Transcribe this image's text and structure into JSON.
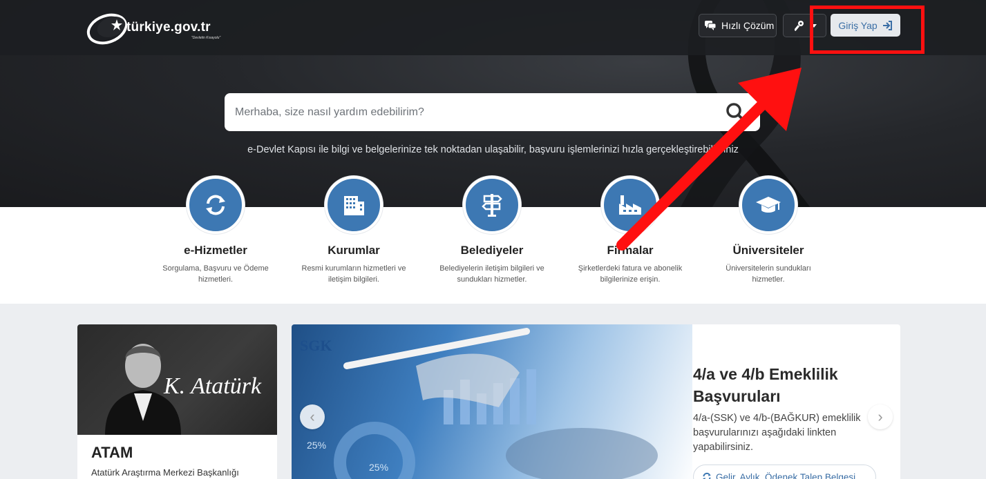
{
  "header": {
    "logo_text": "türkiye.gov.tr",
    "logo_sub": "\"Devletin Kısayolu\"",
    "hizli_cozum_label": "Hızlı Çözüm",
    "giris_label": "Giriş Yap"
  },
  "search": {
    "placeholder": "Merhaba, size nasıl yardım edebilirim?"
  },
  "tagline": "e-Devlet Kapısı ile bilgi ve belgelerinize tek noktadan ulaşabilir, başvuru işlemlerinizi hızla gerçekleştirebilirsiniz",
  "categories": [
    {
      "title": "e-Hizmetler",
      "desc": "Sorgulama, Başvuru ve Ödeme hizmetleri.",
      "icon": "refresh-icon"
    },
    {
      "title": "Kurumlar",
      "desc": "Resmi kurumların hizmetleri ve iletişim bilgileri.",
      "icon": "building-icon"
    },
    {
      "title": "Belediyeler",
      "desc": "Belediyelerin iletişim bilgileri ve sundukları hizmetler.",
      "icon": "signpost-icon"
    },
    {
      "title": "Firmalar",
      "desc": "Şirketlerdeki fatura ve abonelik bilgilerinize erişin.",
      "icon": "factory-icon"
    },
    {
      "title": "Üniversiteler",
      "desc": "Üniversitelerin sundukları hizmetler.",
      "icon": "graduation-cap-icon"
    }
  ],
  "atam": {
    "title": "ATAM",
    "subtitle": "Atatürk Araştırma Merkezi Başkanlığı",
    "signature": "K. Atatürk"
  },
  "slider": {
    "brand": "SGK",
    "title": "4/a ve 4/b Emeklilik Başvuruları",
    "text": "4/a-(SSK) ve 4/b-(BAĞKUR) emeklilik başvurularınızı aşağıdaki linkten yapabilirsiniz.",
    "link": "Gelir, Aylık, Ödenek Talep Belgesi",
    "chart_labels": [
      "25%",
      "25%"
    ]
  },
  "colors": {
    "accent": "#3d78b3",
    "highlight": "#ff1010"
  }
}
